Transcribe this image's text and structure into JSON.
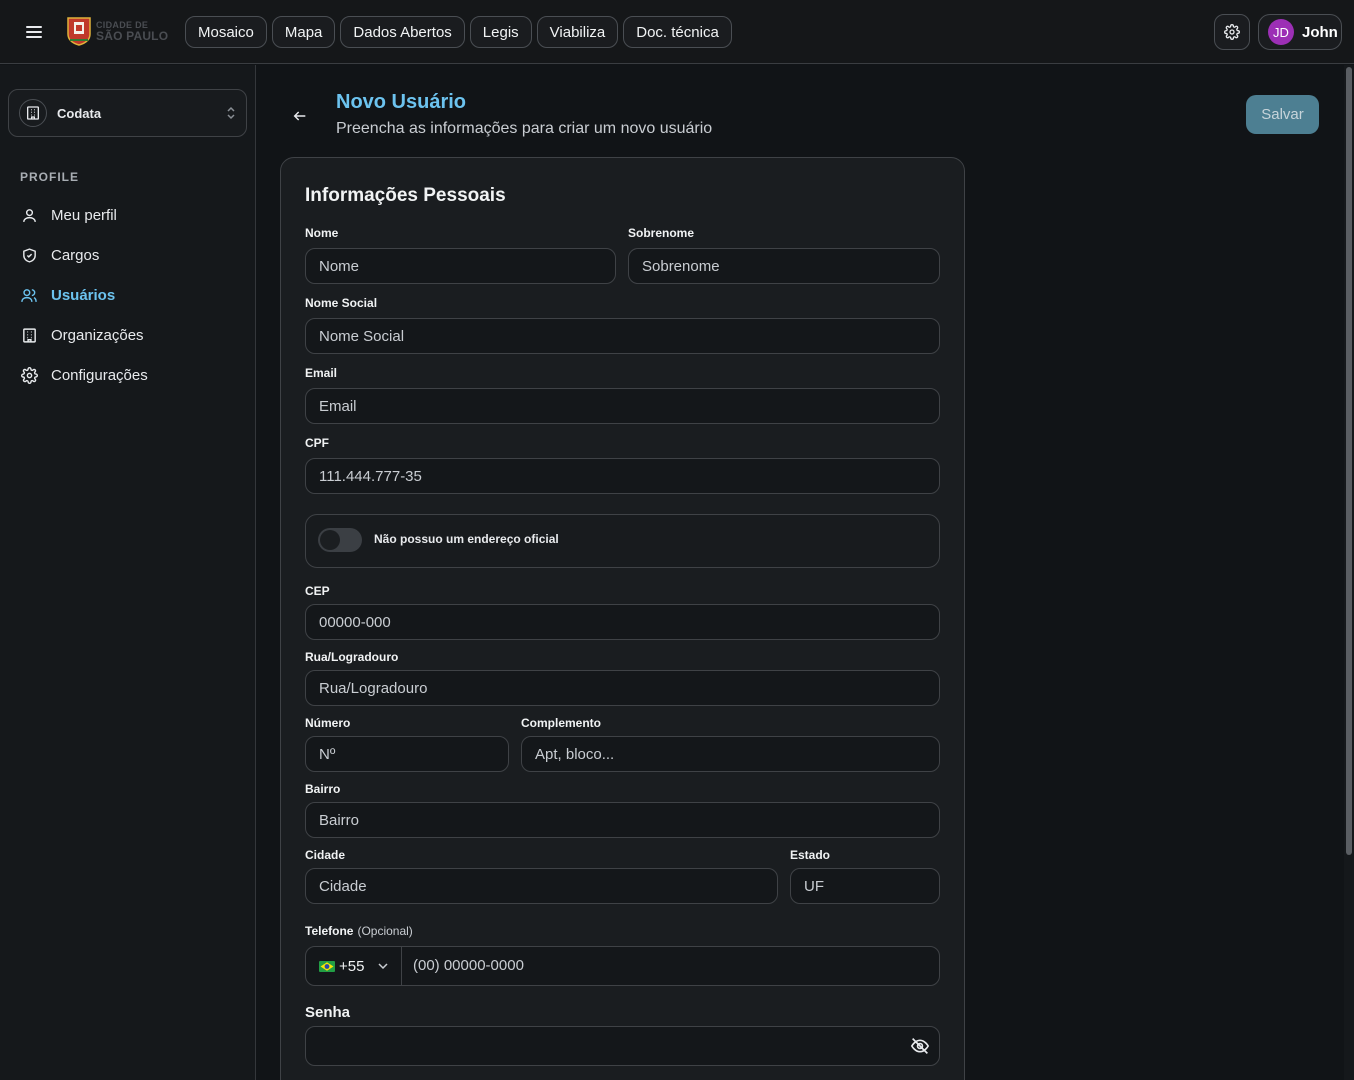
{
  "topbar": {
    "logo_line1": "CIDADE DE",
    "logo_line2": "SÃO PAULO",
    "nav": [
      "Mosaico",
      "Mapa",
      "Dados Abertos",
      "Legis",
      "Viabiliza",
      "Doc. técnica"
    ],
    "user_initials": "JD",
    "user_name": "John"
  },
  "sidebar": {
    "org_name": "Codata",
    "section_label": "PROFILE",
    "items": [
      {
        "label": "Meu perfil",
        "icon": "user-icon"
      },
      {
        "label": "Cargos",
        "icon": "shield-icon"
      },
      {
        "label": "Usuários",
        "icon": "users-icon",
        "active": true
      },
      {
        "label": "Organizações",
        "icon": "building-icon"
      },
      {
        "label": "Configurações",
        "icon": "gear-icon"
      }
    ]
  },
  "header": {
    "title": "Novo Usuário",
    "subtitle": "Preencha as informações para criar um novo usuário",
    "save_label": "Salvar"
  },
  "form": {
    "section_title": "Informações Pessoais",
    "nome_label": "Nome",
    "nome_placeholder": "Nome",
    "sobrenome_label": "Sobrenome",
    "sobrenome_placeholder": "Sobrenome",
    "nome_social_label": "Nome Social",
    "nome_social_placeholder": "Nome Social",
    "email_label": "Email",
    "email_placeholder": "Email",
    "cpf_label": "CPF",
    "cpf_value": "111.444.777-35",
    "no_address_label": "Não possuo um endereço oficial",
    "no_address_checked": false,
    "cep_label": "CEP",
    "cep_placeholder": "00000-000",
    "rua_label": "Rua/Logradouro",
    "rua_placeholder": "Rua/Logradouro",
    "numero_label": "Número",
    "numero_placeholder": "Nº",
    "complemento_label": "Complemento",
    "complemento_placeholder": "Apt, bloco...",
    "bairro_label": "Bairro",
    "bairro_placeholder": "Bairro",
    "cidade_label": "Cidade",
    "cidade_placeholder": "Cidade",
    "estado_label": "Estado",
    "estado_placeholder": "UF",
    "telefone_label": "Telefone",
    "telefone_optional": "(Opcional)",
    "phone_country_code": "+55",
    "phone_placeholder": "(00) 00000-0000",
    "senha_label": "Senha"
  },
  "colors": {
    "accent": "#6cc3ef",
    "save_button": "#4d7f92",
    "avatar": "#9c2fb5",
    "background": "#111417"
  }
}
